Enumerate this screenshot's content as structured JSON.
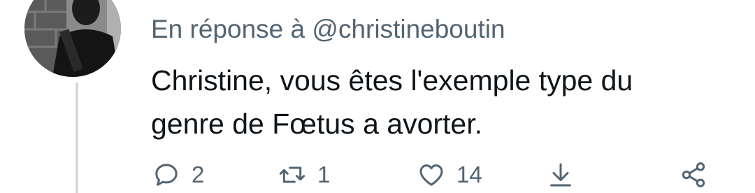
{
  "tweet": {
    "avatar_icon": "user-avatar",
    "reply_prefix": "En réponse à",
    "reply_handle": "@christineboutin",
    "text_line1": "Christine, vous êtes l'exemple type du",
    "text_line2": "genre de Fœtus a avorter."
  },
  "actions": {
    "reply": {
      "icon": "reply-icon",
      "count": "2"
    },
    "retweet": {
      "icon": "retweet-icon",
      "count": "1"
    },
    "like": {
      "icon": "heart-icon",
      "count": "14"
    },
    "download": {
      "icon": "download-icon"
    },
    "share": {
      "icon": "share-icon"
    }
  },
  "colors": {
    "text_primary": "#0f1419",
    "text_secondary": "#536471",
    "thread_line": "#cfd9de",
    "background": "#ffffff"
  }
}
